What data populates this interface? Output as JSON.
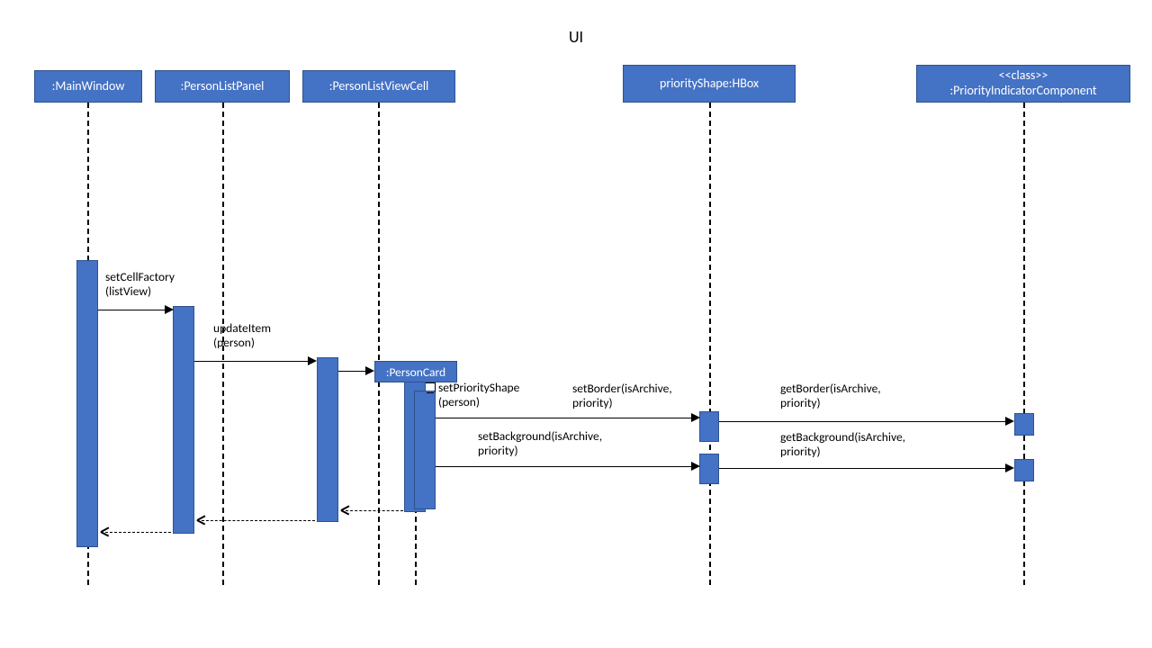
{
  "title": "UI",
  "participants": {
    "p1": ":MainWindow",
    "p2": ":PersonListPanel",
    "p3": ":PersonListViewCell",
    "p4": "priorityShape:HBox",
    "p5_stereotype": "<<class>>",
    "p5_name": ":PriorityIndicatorComponent",
    "personCard": ":PersonCard"
  },
  "messages": {
    "m1a": "setCellFactory",
    "m1b": "(listView)",
    "m2a": "updateItem",
    "m2b": "(person)",
    "m3a": "setPriorityShape",
    "m3b": "(person)",
    "m4a": "setBorder(isArchive,",
    "m4b": "priority)",
    "m5a": "setBackground(isArchive,",
    "m5b": "priority)",
    "m6a": "getBorder(isArchive,",
    "m6b": "priority)",
    "m7a": "getBackground(isArchive,",
    "m7b": "priority)"
  }
}
